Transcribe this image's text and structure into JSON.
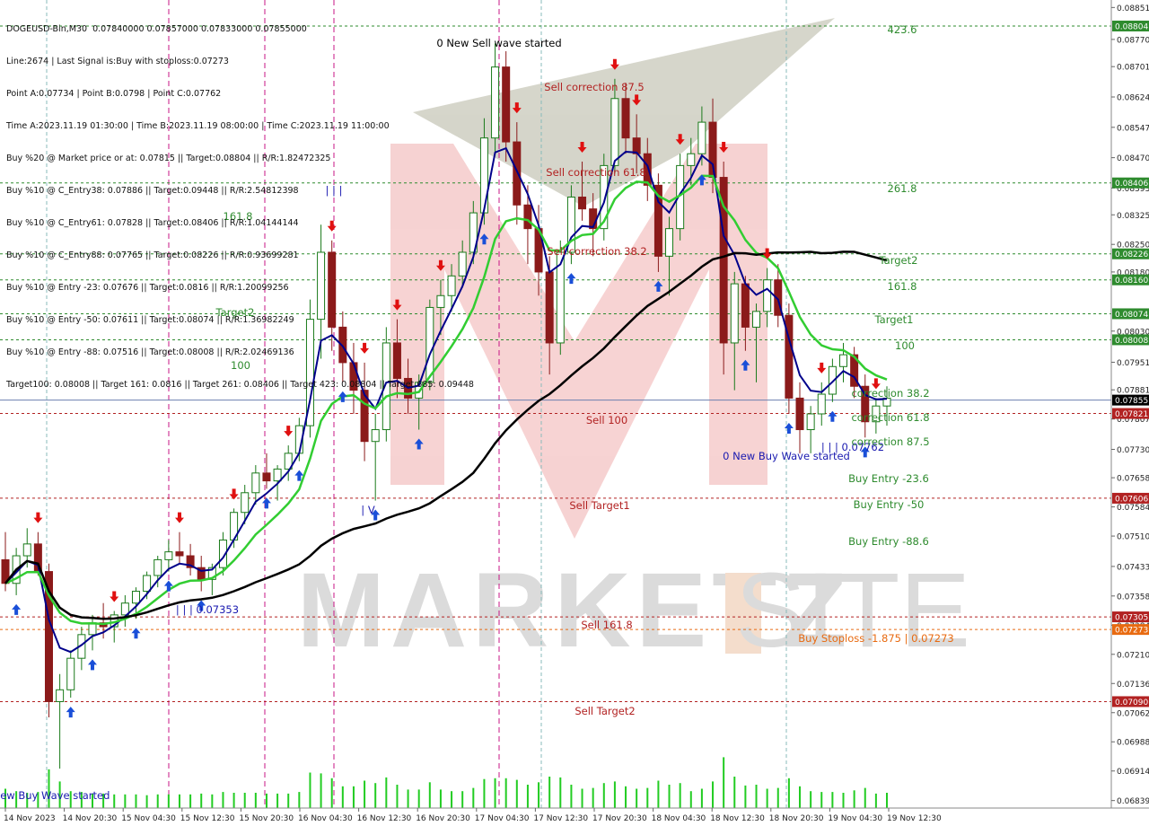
{
  "window": {
    "symbol_line": "DOGEUSD-Bin,M30  0.07840000 0.07857000 0.07833000 0.07855000"
  },
  "info_lines": [
    "Line:2674 | Last Signal is:Buy with stoploss:0.07273",
    "Point A:0.07734 | Point B:0.0798 | Point C:0.07762",
    "Time A:2023.11.19 01:30:00 | Time B:2023.11.19 08:00:00 | Time C:2023.11.19 11:00:00",
    "Buy %20 @ Market price or at: 0.07815 || Target:0.08804 || R/R:1.82472325",
    "Buy %10 @ C_Entry38: 0.07886 || Target:0.09448 || R/R:2.54812398",
    "Buy %10 @ C_Entry61: 0.07828 || Target:0.08406 || R/R:1.04144144",
    "Buy %10 @ C_Entry88: 0.07765 || Target:0.08226 || R/R:0.93699281",
    "Buy %10 @ Entry -23: 0.07676 || Target:0.0816 || R/R:1.20099256",
    "Buy %10 @ Entry -50: 0.07611 || Target:0.08074 || R/R:1.36982249",
    "Buy %10 @ Entry -88: 0.07516 || Target:0.08008 || R/R:2.02469136",
    "Target100: 0.08008 || Target 161: 0.0816 || Target 261: 0.08406 || Target 423: 0.08804 || Target 685: 0.09448"
  ],
  "colors": {
    "candle_up": "#1a7a1a",
    "candle_down": "#8b1a1a",
    "ma_fast": "#00008b",
    "ma_mid": "#32cd32",
    "ma_slow": "#000000",
    "level_green": "#2e8b2e",
    "level_red": "#b22222",
    "level_orange": "#e86a10",
    "buy_arrow": "#1a4fd8",
    "sell_arrow": "#e01010",
    "magenta_vline": "#c71585",
    "current_price_line": "#6b7fb0"
  },
  "chart_data": {
    "type": "candlestick",
    "timeframe": "M30",
    "symbol": "DOGEUSD-Bin",
    "ylim": [
      0.0682,
      0.0887
    ],
    "y_ticks": [
      "0.08851",
      "0.08770",
      "0.08701",
      "0.08624",
      "0.08547",
      "0.08470",
      "0.08393",
      "0.08325",
      "0.08250",
      "0.08180",
      "0.08030",
      "0.07951",
      "0.07881",
      "0.07807",
      "0.07730",
      "0.07658",
      "0.07584",
      "0.07510",
      "0.07433",
      "0.07358",
      "0.07284",
      "0.07210",
      "0.07136",
      "0.07062",
      "0.06988",
      "0.06914",
      "0.06839"
    ],
    "x_ticks": [
      "14 Nov 2023",
      "14 Nov 20:30",
      "15 Nov 04:30",
      "15 Nov 12:30",
      "15 Nov 20:30",
      "16 Nov 04:30",
      "16 Nov 12:30",
      "16 Nov 20:30",
      "17 Nov 04:30",
      "17 Nov 12:30",
      "17 Nov 20:30",
      "18 Nov 04:30",
      "18 Nov 12:30",
      "18 Nov 20:30",
      "19 Nov 04:30",
      "19 Nov 12:30"
    ],
    "price_markers": [
      {
        "label": "0.08804",
        "value": 0.08804,
        "color": "#2e8b2e"
      },
      {
        "label": "0.08406",
        "value": 0.08406,
        "color": "#2e8b2e"
      },
      {
        "label": "0.08226",
        "value": 0.08226,
        "color": "#2e8b2e"
      },
      {
        "label": "0.08160",
        "value": 0.0816,
        "color": "#2e8b2e"
      },
      {
        "label": "0.08074",
        "value": 0.08074,
        "color": "#2e8b2e"
      },
      {
        "label": "0.08008",
        "value": 0.08008,
        "color": "#2e8b2e"
      },
      {
        "label": "0.07855",
        "value": 0.07855,
        "color": "#000000"
      },
      {
        "label": "0.07821",
        "value": 0.07821,
        "color": "#b22222"
      },
      {
        "label": "0.07606",
        "value": 0.07606,
        "color": "#b22222"
      },
      {
        "label": "0.07305",
        "value": 0.07305,
        "color": "#b22222"
      },
      {
        "label": "0.07273",
        "value": 0.07273,
        "color": "#e86a10"
      },
      {
        "label": "0.07090",
        "value": 0.0709,
        "color": "#b22222"
      }
    ],
    "level_lines": [
      {
        "value": 0.08804,
        "color": "#2e8b2e",
        "style": "dashed"
      },
      {
        "value": 0.08406,
        "color": "#2e8b2e",
        "style": "dashed"
      },
      {
        "value": 0.08226,
        "color": "#2e8b2e",
        "style": "dashed"
      },
      {
        "value": 0.0816,
        "color": "#2e8b2e",
        "style": "dashed"
      },
      {
        "value": 0.08074,
        "color": "#2e8b2e",
        "style": "dashed"
      },
      {
        "value": 0.08008,
        "color": "#2e8b2e",
        "style": "dashed"
      },
      {
        "value": 0.07855,
        "color": "#6b7fb0",
        "style": "solid"
      },
      {
        "value": 0.07821,
        "color": "#b22222",
        "style": "dashed"
      },
      {
        "value": 0.07606,
        "color": "#b22222",
        "style": "dashed"
      },
      {
        "value": 0.07305,
        "color": "#b22222",
        "style": "dashed"
      },
      {
        "value": 0.07273,
        "color": "#e86a10",
        "style": "dashed"
      },
      {
        "value": 0.0709,
        "color": "#b22222",
        "style": "dashed"
      }
    ],
    "annotations": [
      {
        "text": "423.6",
        "color": "#2e8b2e"
      },
      {
        "text": "261.8",
        "color": "#2e8b2e"
      },
      {
        "text": "Target2",
        "color": "#2e8b2e"
      },
      {
        "text": "161.8",
        "color": "#2e8b2e"
      },
      {
        "text": "Target1",
        "color": "#2e8b2e"
      },
      {
        "text": "100",
        "color": "#2e8b2e"
      },
      {
        "text": "161.8",
        "color": "#2e8b2e"
      },
      {
        "text": "Target2",
        "color": "#2e8b2e"
      },
      {
        "text": "100",
        "color": "#2e8b2e"
      },
      {
        "text": "Sell correction 87.5",
        "color": "#b22222"
      },
      {
        "text": "Sell correction 61.8",
        "color": "#b22222"
      },
      {
        "text": "Sell correction 38.2",
        "color": "#b22222"
      },
      {
        "text": "Sell 100",
        "color": "#b22222"
      },
      {
        "text": "Sell Target1",
        "color": "#b22222"
      },
      {
        "text": "Sell 161.8",
        "color": "#b22222"
      },
      {
        "text": "Sell Target2",
        "color": "#b22222"
      },
      {
        "text": "0 New Sell wave started",
        "color": "#000000"
      },
      {
        "text": "0 New Buy Wave started",
        "color": "#1a1ab0"
      },
      {
        "text": "New Buy Wave started",
        "color": "#1a1ab0"
      },
      {
        "text": "| | | 0.07353",
        "color": "#1a1ab0"
      },
      {
        "text": "| | | 0.07762",
        "color": "#1a1ab0"
      },
      {
        "text": "| | |",
        "color": "#1a1ab0"
      },
      {
        "text": "| V",
        "color": "#1a1ab0"
      },
      {
        "text": "correction 38.2",
        "color": "#2e8b2e"
      },
      {
        "text": "correction 61.8",
        "color": "#2e8b2e"
      },
      {
        "text": "correction 87.5",
        "color": "#2e8b2e"
      },
      {
        "text": "Buy Entry -23.6",
        "color": "#2e8b2e"
      },
      {
        "text": "Buy Entry -50",
        "color": "#2e8b2e"
      },
      {
        "text": "Buy Entry -88.6",
        "color": "#2e8b2e"
      },
      {
        "text": "Buy Stoploss -1.875 | 0.07273",
        "color": "#e86a10"
      }
    ],
    "series": [
      {
        "values": [
          [
            0.0745,
            0.0752,
            0.0737,
            0.0739
          ],
          [
            0.0739,
            0.0748,
            0.0736,
            0.0746
          ],
          [
            0.0746,
            0.0753,
            0.0743,
            0.0749
          ],
          [
            0.0749,
            0.0752,
            0.0741,
            0.0742
          ],
          [
            0.0742,
            0.0744,
            0.0705,
            0.0709
          ],
          [
            0.0709,
            0.0716,
            0.0692,
            0.0712
          ],
          [
            0.0712,
            0.0722,
            0.071,
            0.072
          ],
          [
            0.072,
            0.0728,
            0.0717,
            0.0726
          ],
          [
            0.0726,
            0.0731,
            0.0722,
            0.0729
          ],
          [
            0.0729,
            0.0734,
            0.0725,
            0.0728
          ],
          [
            0.0728,
            0.0732,
            0.0724,
            0.0731
          ],
          [
            0.0731,
            0.0736,
            0.0728,
            0.0734
          ],
          [
            0.0734,
            0.0738,
            0.073,
            0.0737
          ],
          [
            0.0737,
            0.0742,
            0.0735,
            0.0741
          ],
          [
            0.0741,
            0.0746,
            0.0738,
            0.0745
          ],
          [
            0.0745,
            0.075,
            0.0742,
            0.0747
          ],
          [
            0.0747,
            0.0752,
            0.0744,
            0.0746
          ],
          [
            0.0746,
            0.0749,
            0.0741,
            0.0743
          ],
          [
            0.0743,
            0.0746,
            0.0737,
            0.074
          ],
          [
            0.074,
            0.0744,
            0.0736,
            0.0743
          ],
          [
            0.0743,
            0.0752,
            0.0741,
            0.075
          ],
          [
            0.075,
            0.0758,
            0.0748,
            0.0757
          ],
          [
            0.0757,
            0.0764,
            0.0754,
            0.0762
          ],
          [
            0.0762,
            0.0769,
            0.0759,
            0.0767
          ],
          [
            0.0767,
            0.0772,
            0.0763,
            0.0765
          ],
          [
            0.0765,
            0.0769,
            0.076,
            0.0768
          ],
          [
            0.0768,
            0.0774,
            0.0765,
            0.0772
          ],
          [
            0.0772,
            0.0781,
            0.077,
            0.0779
          ],
          [
            0.0779,
            0.0811,
            0.0776,
            0.0806
          ],
          [
            0.0806,
            0.083,
            0.0796,
            0.0823
          ],
          [
            0.0823,
            0.0826,
            0.0798,
            0.0804
          ],
          [
            0.0804,
            0.0808,
            0.079,
            0.0795
          ],
          [
            0.0795,
            0.08,
            0.0782,
            0.0788
          ],
          [
            0.0788,
            0.0795,
            0.077,
            0.0775
          ],
          [
            0.0775,
            0.0782,
            0.076,
            0.0778
          ],
          [
            0.0778,
            0.0804,
            0.0775,
            0.08
          ],
          [
            0.08,
            0.0806,
            0.0786,
            0.0791
          ],
          [
            0.0791,
            0.0796,
            0.0782,
            0.0786
          ],
          [
            0.0786,
            0.0792,
            0.0778,
            0.079
          ],
          [
            0.079,
            0.0811,
            0.0788,
            0.0809
          ],
          [
            0.0809,
            0.0816,
            0.0802,
            0.0812
          ],
          [
            0.0812,
            0.082,
            0.0808,
            0.0817
          ],
          [
            0.0817,
            0.0826,
            0.0814,
            0.0823
          ],
          [
            0.0823,
            0.0836,
            0.082,
            0.0833
          ],
          [
            0.0833,
            0.0857,
            0.083,
            0.0852
          ],
          [
            0.0852,
            0.0876,
            0.0848,
            0.087
          ],
          [
            0.087,
            0.0874,
            0.0846,
            0.0851
          ],
          [
            0.0851,
            0.0856,
            0.083,
            0.0835
          ],
          [
            0.0835,
            0.084,
            0.082,
            0.0829
          ],
          [
            0.0829,
            0.0835,
            0.0812,
            0.0818
          ],
          [
            0.0818,
            0.0822,
            0.0792,
            0.08
          ],
          [
            0.08,
            0.0826,
            0.0797,
            0.0823
          ],
          [
            0.0823,
            0.084,
            0.082,
            0.0837
          ],
          [
            0.0837,
            0.0846,
            0.0831,
            0.0834
          ],
          [
            0.0834,
            0.0838,
            0.0822,
            0.0829
          ],
          [
            0.0829,
            0.0848,
            0.0826,
            0.0845
          ],
          [
            0.0845,
            0.0867,
            0.0843,
            0.0862
          ],
          [
            0.0862,
            0.0866,
            0.0848,
            0.0852
          ],
          [
            0.0852,
            0.0858,
            0.0843,
            0.0848
          ],
          [
            0.0848,
            0.0852,
            0.0836,
            0.084
          ],
          [
            0.084,
            0.0843,
            0.0818,
            0.0822
          ],
          [
            0.0822,
            0.0832,
            0.0812,
            0.0829
          ],
          [
            0.0829,
            0.0848,
            0.0826,
            0.0845
          ],
          [
            0.0845,
            0.0852,
            0.084,
            0.0848
          ],
          [
            0.0848,
            0.086,
            0.0845,
            0.0856
          ],
          [
            0.0856,
            0.0862,
            0.0838,
            0.0842
          ],
          [
            0.0842,
            0.0846,
            0.0792,
            0.08
          ],
          [
            0.08,
            0.0818,
            0.0788,
            0.0815
          ],
          [
            0.0815,
            0.0817,
            0.0798,
            0.0804
          ],
          [
            0.0804,
            0.081,
            0.079,
            0.0808
          ],
          [
            0.0808,
            0.0819,
            0.0804,
            0.0816
          ],
          [
            0.0816,
            0.082,
            0.0804,
            0.0807
          ],
          [
            0.0807,
            0.081,
            0.0782,
            0.0786
          ],
          [
            0.0786,
            0.079,
            0.0772,
            0.0778
          ],
          [
            0.0778,
            0.0784,
            0.0772,
            0.0782
          ],
          [
            0.0782,
            0.079,
            0.0779,
            0.0787
          ],
          [
            0.0787,
            0.0796,
            0.0785,
            0.0794
          ],
          [
            0.0794,
            0.08,
            0.079,
            0.0797
          ],
          [
            0.0797,
            0.0799,
            0.0786,
            0.0789
          ],
          [
            0.0789,
            0.0792,
            0.0776,
            0.078
          ],
          [
            0.078,
            0.0786,
            0.0777,
            0.0784
          ],
          [
            0.0784,
            0.0789,
            0.0779,
            0.0786
          ]
        ]
      }
    ]
  }
}
